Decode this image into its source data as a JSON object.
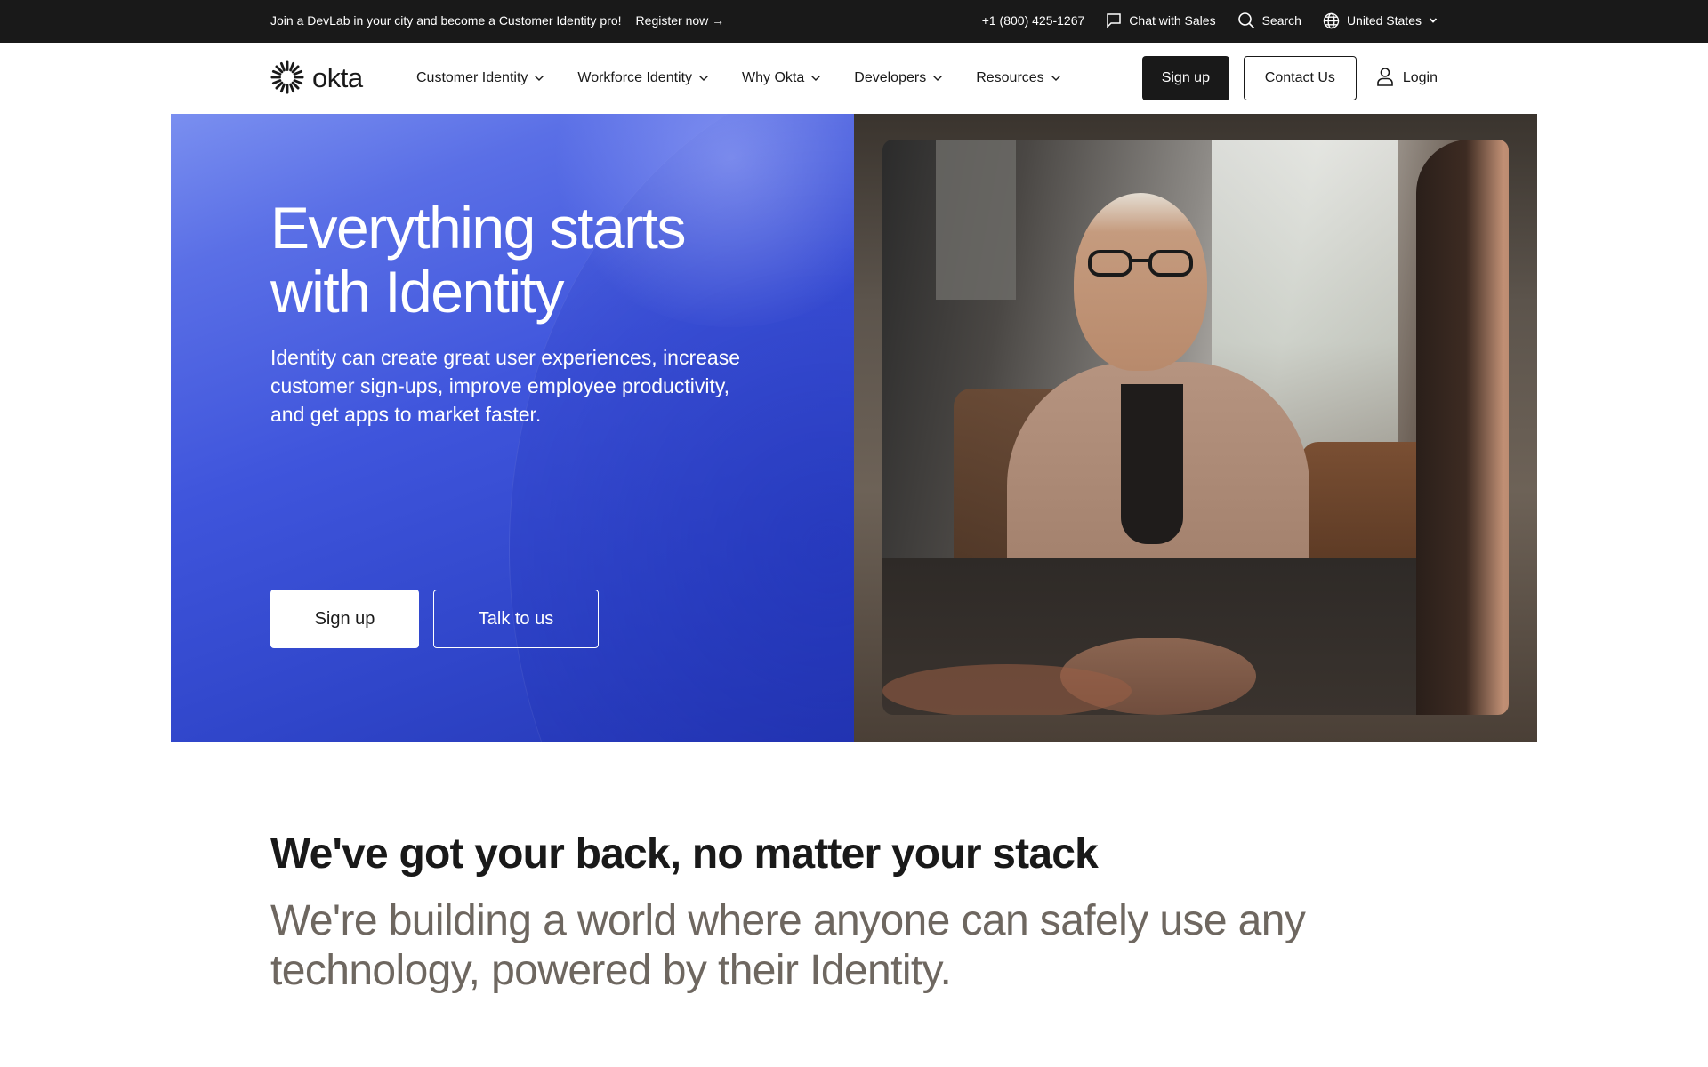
{
  "topbar": {
    "promo_text": "Join a DevLab in your city and become a Customer Identity pro!",
    "promo_link": "Register now →",
    "phone": "+1 (800) 425-1267",
    "chat_label": "Chat with Sales",
    "search_label": "Search",
    "region_label": "United States",
    "icons": [
      "chat-icon",
      "search-icon",
      "globe-icon",
      "chevron-down-icon"
    ]
  },
  "nav": {
    "logo_text": "okta",
    "menu": [
      {
        "label": "Customer Identity"
      },
      {
        "label": "Workforce Identity"
      },
      {
        "label": "Why Okta"
      },
      {
        "label": "Developers"
      },
      {
        "label": "Resources"
      }
    ],
    "signup_label": "Sign up",
    "contact_label": "Contact Us",
    "login_label": "Login"
  },
  "hero": {
    "title": "Everything starts with Identity",
    "subtitle": "Identity can create great user experiences, increase customer sign-ups, improve employee productivity, and get apps to market faster.",
    "primary_cta": "Sign up",
    "secondary_cta": "Talk to us"
  },
  "section": {
    "heading": "We've got your back, no matter your stack",
    "body": "We're building a world where anyone can safely use any technology, powered by their Identity."
  },
  "colors": {
    "topbar_bg": "#191919",
    "hero_blue": "#3f55dc",
    "text_dark": "#191919",
    "text_muted": "#6e6760"
  }
}
